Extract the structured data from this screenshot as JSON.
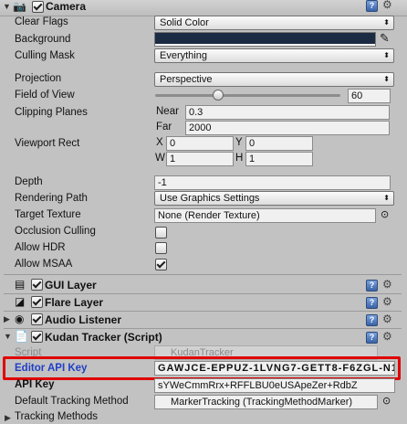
{
  "camera": {
    "title": "Camera",
    "enabled": true,
    "fields": {
      "clear_flags": {
        "label": "Clear Flags",
        "value": "Solid Color"
      },
      "background": {
        "label": "Background",
        "color": "#1c2b44"
      },
      "culling_mask": {
        "label": "Culling Mask",
        "value": "Everything"
      },
      "projection": {
        "label": "Projection",
        "value": "Perspective"
      },
      "fov": {
        "label": "Field of View",
        "value": "60",
        "slider_fraction": 0.33
      },
      "clipping": {
        "label": "Clipping Planes",
        "near_label": "Near",
        "near": "0.3",
        "far_label": "Far",
        "far": "2000"
      },
      "viewport": {
        "label": "Viewport Rect",
        "x_label": "X",
        "x": "0",
        "y_label": "Y",
        "y": "0",
        "w_label": "W",
        "w": "1",
        "h_label": "H",
        "h": "1"
      },
      "depth": {
        "label": "Depth",
        "value": "-1"
      },
      "rendering_path": {
        "label": "Rendering Path",
        "value": "Use Graphics Settings"
      },
      "target_texture": {
        "label": "Target Texture",
        "value": "None (Render Texture)"
      },
      "occlusion": {
        "label": "Occlusion Culling",
        "checked": false
      },
      "hdr": {
        "label": "Allow HDR",
        "checked": false
      },
      "msaa": {
        "label": "Allow MSAA",
        "checked": true
      }
    }
  },
  "components": [
    {
      "title": "GUI Layer",
      "enabled": true
    },
    {
      "title": "Flare Layer",
      "enabled": true
    },
    {
      "title": "Audio Listener",
      "enabled": true
    }
  ],
  "kudan": {
    "title": "Kudan Tracker (Script)",
    "enabled": true,
    "script_label": "Script",
    "script_value": "KudanTracker",
    "editor_key_label": "Editor API Key",
    "editor_key_value": "GAWJCE-EPPUZ-1LVNG7-GETT8-F6ZGL-N1",
    "api_key_label": "API Key",
    "api_key_value": "sYWeCmmRrx+RFFLBU0eUSApeZer+RdbZ",
    "tracking_label": "Default Tracking Method",
    "tracking_value": "MarkerTracking (TrackingMethodMarker)",
    "tracking_methods_label": "Tracking Methods"
  },
  "colors": {
    "highlight": "#e00000",
    "link_blue": "#1f3fc7"
  },
  "icons": [
    "fold-triangle-icon",
    "camera-icon",
    "help-icon",
    "gear-icon",
    "eyedropper-icon",
    "object-picker-icon",
    "gui-layer-icon",
    "flare-layer-icon",
    "audio-listener-icon",
    "script-icon"
  ]
}
